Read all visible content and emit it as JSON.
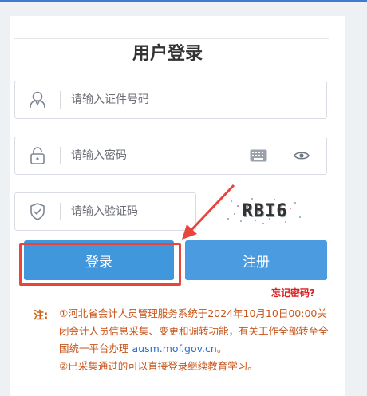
{
  "title": "用户登录",
  "fields": {
    "id_placeholder": "请输入证件号码",
    "password_placeholder": "请输入密码",
    "captcha_placeholder": "请输入验证码"
  },
  "captcha": {
    "text": "RBI6"
  },
  "buttons": {
    "login": "登录",
    "register": "注册"
  },
  "forgot_password": "忘记密码?",
  "notice": {
    "label": "注:",
    "line1_prefix": "①河北省会计人员管理服务系统于2024年10月10日00:00关闭会计人员信息采集、变更和调转功能，有关工作全部转至全国统一平台办理",
    "link": "ausm.mof.gov.cn",
    "line1_suffix": "。",
    "line2": "②已采集通过的可以直接登录继续教育学习。"
  },
  "icons": [
    "user-icon",
    "lock-icon",
    "shield-icon",
    "keyboard-icon",
    "eye-icon"
  ],
  "colors": {
    "primary": "#4197dc",
    "highlight": "#e8453c",
    "warning": "#c8541a",
    "link": "#2f6fc5"
  }
}
